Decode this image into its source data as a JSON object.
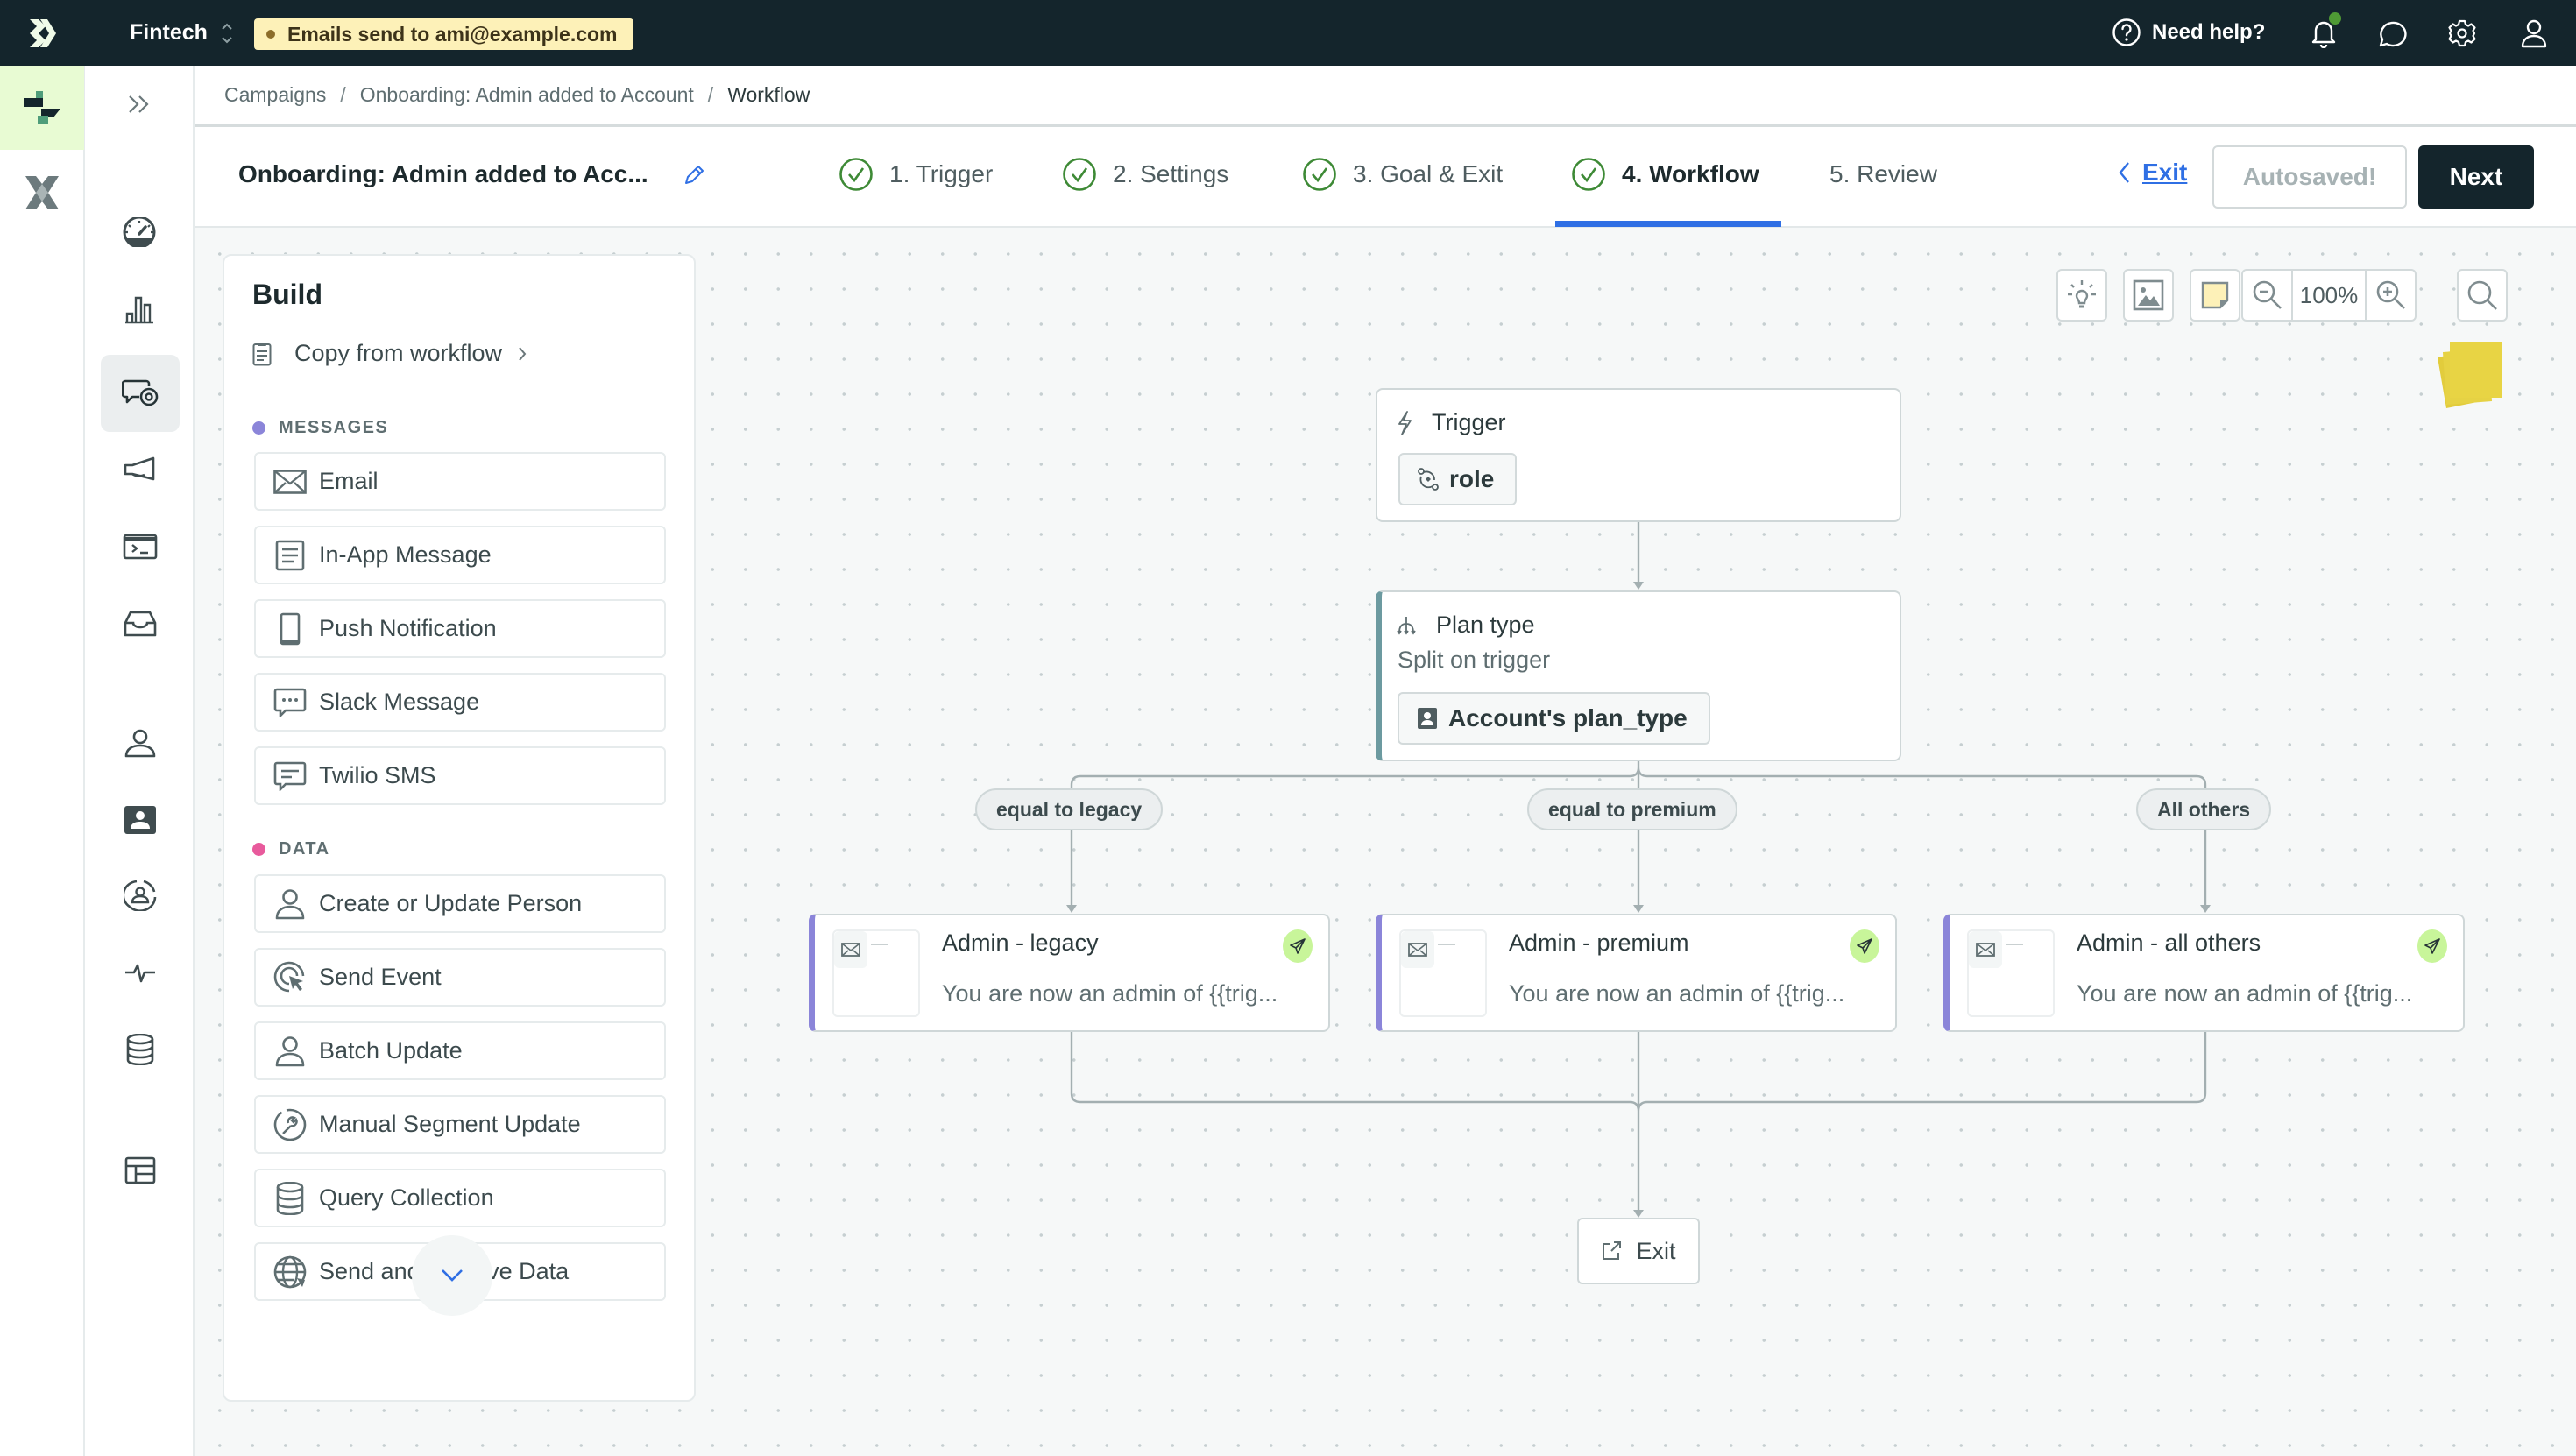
{
  "topbar": {
    "workspace": "Fintech",
    "email_notice": "Emails send to ami@example.com",
    "help_label": "Need help?",
    "colors": {
      "bar": "#14252c",
      "notice_bg": "#fdf1b8",
      "notification_dot": "#4f9a35"
    }
  },
  "rail1": {
    "items": [
      {
        "icon": "journeys-logo-icon",
        "active": true
      },
      {
        "icon": "cross-product-icon",
        "active": false
      }
    ]
  },
  "rail2": {
    "items": [
      {
        "icon": "expand-chevrons-icon"
      },
      {
        "icon": "dashboard-gauge-icon"
      },
      {
        "icon": "analytics-bar-chart-icon"
      },
      {
        "icon": "campaigns-message-icon",
        "active": true
      },
      {
        "icon": "broadcast-megaphone-icon"
      },
      {
        "icon": "terminal-icon"
      },
      {
        "icon": "inbox-tray-icon"
      },
      {
        "icon": "people-icon"
      },
      {
        "icon": "contact-card-icon"
      },
      {
        "icon": "segments-icon"
      },
      {
        "icon": "activity-pulse-icon"
      },
      {
        "icon": "database-icon"
      },
      {
        "icon": "table-icon"
      }
    ]
  },
  "breadcrumb": {
    "items": [
      "Campaigns",
      "Onboarding: Admin added to Account",
      "Workflow"
    ],
    "separator": "/"
  },
  "header": {
    "campaign_title": "Onboarding: Admin added to Acc...",
    "steps": [
      {
        "label": "1. Trigger",
        "complete": true
      },
      {
        "label": "2. Settings",
        "complete": true
      },
      {
        "label": "3. Goal & Exit",
        "complete": true
      },
      {
        "label": "4. Workflow",
        "complete": true,
        "active": true
      },
      {
        "label": "5. Review",
        "complete": false
      }
    ],
    "exit_label": "Exit",
    "autosaved_label": "Autosaved!",
    "next_label": "Next",
    "colors": {
      "accent": "#2f6fe4",
      "check": "#3e8a36"
    }
  },
  "build": {
    "title": "Build",
    "copy_label": "Copy from workflow",
    "sections": [
      {
        "label": "MESSAGES",
        "color": "#8b85d9",
        "items": [
          "Email",
          "In-App Message",
          "Push Notification",
          "Slack Message",
          "Twilio SMS"
        ]
      },
      {
        "label": "DATA",
        "color": "#e85a9c",
        "items": [
          "Create or Update Person",
          "Send Event",
          "Batch Update",
          "Manual Segment Update",
          "Query Collection",
          "Send and Receive Data"
        ]
      }
    ]
  },
  "canvas_toolbar": {
    "zoom_level": "100%"
  },
  "workflow": {
    "trigger": {
      "title": "Trigger",
      "attribute": "role"
    },
    "split": {
      "title": "Plan type",
      "subtitle": "Split on trigger",
      "attribute": "Account's plan_type"
    },
    "branches": [
      {
        "condition": "equal to legacy",
        "message": {
          "title": "Admin - legacy",
          "preview": "You are now an admin of {{trig...",
          "status": "active"
        }
      },
      {
        "condition": "equal to premium",
        "message": {
          "title": "Admin - premium",
          "preview": "You are now an admin of {{trig...",
          "status": "active"
        }
      },
      {
        "condition": "All others",
        "message": {
          "title": "Admin - all others",
          "preview": "You are now an admin of {{trig...",
          "status": "active"
        }
      }
    ],
    "exit_label": "Exit"
  }
}
